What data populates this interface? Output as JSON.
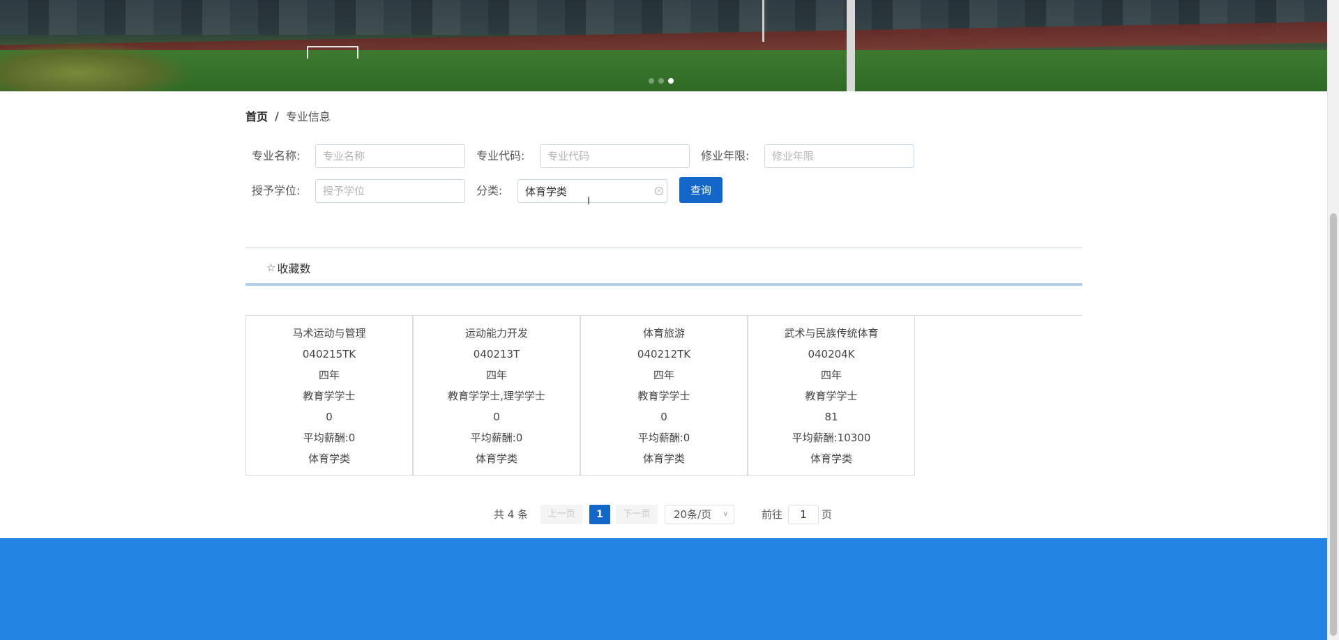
{
  "banner": {
    "carousel_dots": 3,
    "active_dot": 3
  },
  "breadcrumb": {
    "home": "首页",
    "separator": "/",
    "current": "专业信息"
  },
  "search": {
    "name_label": "专业名称:",
    "name_placeholder": "专业名称",
    "code_label": "专业代码:",
    "code_placeholder": "专业代码",
    "years_label": "修业年限:",
    "years_placeholder": "修业年限",
    "degree_label": "授予学位:",
    "degree_placeholder": "授予学位",
    "category_label": "分类:",
    "category_value": "体育学类",
    "submit_label": "查询"
  },
  "sort": {
    "favorites_label": "收藏数",
    "star_icon": "star-outline-icon"
  },
  "majors": [
    {
      "name": "马术运动与管理",
      "code": "040215TK",
      "years": "四年",
      "degree": "教育学学士",
      "favorites": "0",
      "salary": "平均薪酬:0",
      "category": "体育学类"
    },
    {
      "name": "运动能力开发",
      "code": "040213T",
      "years": "四年",
      "degree": "教育学学士,理学学士",
      "favorites": "0",
      "salary": "平均薪酬:0",
      "category": "体育学类"
    },
    {
      "name": "体育旅游",
      "code": "040212TK",
      "years": "四年",
      "degree": "教育学学士",
      "favorites": "0",
      "salary": "平均薪酬:0",
      "category": "体育学类"
    },
    {
      "name": "武术与民族传统体育",
      "code": "040204K",
      "years": "四年",
      "degree": "教育学学士",
      "favorites": "81",
      "salary": "平均薪酬:10300",
      "category": "体育学类"
    }
  ],
  "pagination": {
    "total": "共 4 条",
    "prev": "上一页",
    "current_page": "1",
    "next": "下一页",
    "page_size": "20条/页",
    "goto_label": "前往",
    "goto_value": "1",
    "goto_suffix": "页"
  },
  "colors": {
    "primary": "#1367c9",
    "footer": "#2384e3"
  }
}
